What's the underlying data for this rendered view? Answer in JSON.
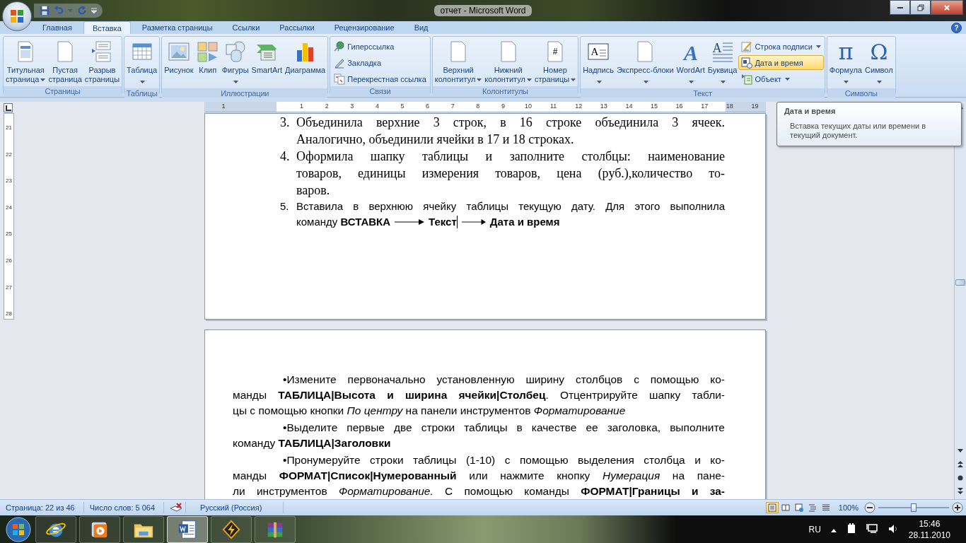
{
  "window": {
    "title": "отчет - Microsoft Word",
    "help": "?"
  },
  "tabs": [
    {
      "label": "Главная",
      "selected": false
    },
    {
      "label": "Вставка",
      "selected": true
    },
    {
      "label": "Разметка страницы",
      "selected": false
    },
    {
      "label": "Ссылки",
      "selected": false
    },
    {
      "label": "Рассылки",
      "selected": false
    },
    {
      "label": "Рецензирование",
      "selected": false
    },
    {
      "label": "Вид",
      "selected": false
    }
  ],
  "ribbon": [
    {
      "title": "Страницы",
      "buttons": [
        {
          "kind": "large",
          "lines": [
            "Титульная",
            "страница"
          ],
          "dropdown": true,
          "selected": false
        },
        {
          "kind": "large",
          "lines": [
            "Пустая",
            "страница"
          ],
          "dropdown": false,
          "selected": false
        },
        {
          "kind": "large",
          "lines": [
            "Разрыв",
            "страницы"
          ],
          "dropdown": false,
          "selected": false
        }
      ]
    },
    {
      "title": "Таблицы",
      "buttons": [
        {
          "kind": "large",
          "lines": [
            "Таблица"
          ],
          "dropdown": true,
          "selected": false
        }
      ]
    },
    {
      "title": "Иллюстрации",
      "buttons": [
        {
          "kind": "large",
          "lines": [
            "Рисунок"
          ],
          "dropdown": false,
          "selected": false
        },
        {
          "kind": "large",
          "lines": [
            "Клип"
          ],
          "dropdown": false,
          "selected": false
        },
        {
          "kind": "large",
          "lines": [
            "Фигуры"
          ],
          "dropdown": true,
          "selected": false
        },
        {
          "kind": "large",
          "lines": [
            "SmartArt"
          ],
          "dropdown": false,
          "selected": false
        },
        {
          "kind": "large",
          "lines": [
            "Диаграмма"
          ],
          "dropdown": false,
          "selected": false
        }
      ]
    },
    {
      "title": "Связи",
      "buttons": [
        {
          "kind": "small",
          "lines": [
            "Гиперссылка"
          ],
          "dropdown": false,
          "selected": false
        },
        {
          "kind": "small",
          "lines": [
            "Закладка"
          ],
          "dropdown": false,
          "selected": false
        },
        {
          "kind": "small",
          "lines": [
            "Перекрестная ссылка"
          ],
          "dropdown": false,
          "selected": false
        }
      ]
    },
    {
      "title": "Колонтитулы",
      "buttons": [
        {
          "kind": "large",
          "lines": [
            "Верхний",
            "колонтитул"
          ],
          "dropdown": true,
          "selected": false
        },
        {
          "kind": "large",
          "lines": [
            "Нижний",
            "колонтитул"
          ],
          "dropdown": true,
          "selected": false
        },
        {
          "kind": "large",
          "lines": [
            "Номер",
            "страницы"
          ],
          "dropdown": true,
          "selected": false,
          "glyph": "#"
        }
      ]
    },
    {
      "title": "Текст",
      "buttons": [
        {
          "kind": "large",
          "lines": [
            "Надпись"
          ],
          "dropdown": true,
          "selected": false,
          "glyph": "A"
        },
        {
          "kind": "large",
          "lines": [
            "Экспресс-блоки"
          ],
          "dropdown": true,
          "selected": false
        },
        {
          "kind": "large",
          "lines": [
            "WordArt"
          ],
          "dropdown": true,
          "selected": false,
          "glyph": "A"
        },
        {
          "kind": "large",
          "lines": [
            "Буквица"
          ],
          "dropdown": true,
          "selected": false,
          "glyph": "A"
        },
        {
          "kind": "small",
          "lines": [
            "Строка подписи"
          ],
          "dropdown": true,
          "selected": false
        },
        {
          "kind": "small",
          "lines": [
            "Дата и время"
          ],
          "dropdown": false,
          "selected": true
        },
        {
          "kind": "small",
          "lines": [
            "Объект"
          ],
          "dropdown": true,
          "selected": false
        }
      ]
    },
    {
      "title": "Символы",
      "buttons": [
        {
          "kind": "large",
          "lines": [
            "Формула"
          ],
          "dropdown": true,
          "selected": false,
          "glyph": "π"
        },
        {
          "kind": "large",
          "lines": [
            "Символ"
          ],
          "dropdown": true,
          "selected": false,
          "glyph": "Ω"
        }
      ]
    }
  ],
  "ruler": {
    "left_label": "1",
    "labels": [
      "1",
      "2",
      "3",
      "4",
      "5",
      "6",
      "7",
      "8",
      "9",
      "10",
      "11",
      "12",
      "13",
      "14",
      "15",
      "16",
      "17",
      "18",
      "19"
    ]
  },
  "vertical_ruler": {
    "labels": [
      "21",
      "22",
      "23",
      "24",
      "25",
      "26",
      "27",
      "28"
    ]
  },
  "page_1": {
    "items": [
      {
        "number": "3.",
        "kind": "serif",
        "lines": [
          "Объединила верхние 3 строк, в 16 строке объединила 3 ячеек.",
          "Аналогично, объединили ячейки в 17 и 18 строках."
        ]
      },
      {
        "number": "4.",
        "kind": "serif",
        "lines": [
          "Оформила шапку таблицы и заполните столбцы: наименование",
          "товаров, единицы измерения товаров, цена (руб.),количество то-",
          "варов."
        ]
      },
      {
        "number": "5.",
        "kind": "sans",
        "lines": [
          "Вставила в верхнюю ячейку таблицы текущую дату. Для этого выполнила"
        ],
        "command": {
          "prefix": "команду",
          "steps": [
            "ВСТАВКА",
            "Текст",
            "Дата и время"
          ]
        }
      }
    ]
  },
  "page_2": {
    "paragraphs": [
      {
        "continues": false,
        "lines": [
          "•Измените первоначально установленную ширину столбцов с помощью ко-",
          "манды **ТАБЛИЦА|Высота и ширина ячейки|Столбец**. Отцентрируйте шапку табли-",
          "цы с помощью кнопки *По центру* на панели инструментов *Форматирование*"
        ]
      },
      {
        "continues": false,
        "lines": [
          "•Выделите первые две строки таблицы в качестве ее заголовка, выполните",
          "команду **ТАБЛИЦА|Заголовки**"
        ]
      },
      {
        "continues": true,
        "lines": [
          "•Пронумеруйте строки таблицы (1-10) с помощью выделения столбца и ко-",
          "манды **ФОРМАТ|Список|Нумерованный** или нажмите кнопку *Нумерация* на пане-",
          "ли инструментов *Форматирование.* С помощью команды **ФОРМАТ|Границы и за-**"
        ]
      }
    ]
  },
  "tooltip": {
    "title": "Дата и время",
    "text": "Вставка текущих даты или времени в текущий документ."
  },
  "status_bar": {
    "page": "Страница: 22 из 46",
    "words": "Число слов: 5 064",
    "language": "Русский (Россия)",
    "views": [
      {
        "selected": true
      },
      {
        "selected": false
      },
      {
        "selected": false
      },
      {
        "selected": false
      },
      {
        "selected": false
      }
    ],
    "zoom": {
      "reading": "100%",
      "level": 0.5
    }
  },
  "taskbar": {
    "apps": [
      {
        "selected": false
      },
      {
        "selected": false
      },
      {
        "selected": false
      },
      {
        "selected": true
      },
      {
        "selected": false
      },
      {
        "selected": false
      }
    ],
    "language": "RU",
    "time": "15:46",
    "date": "28.11.2010"
  }
}
